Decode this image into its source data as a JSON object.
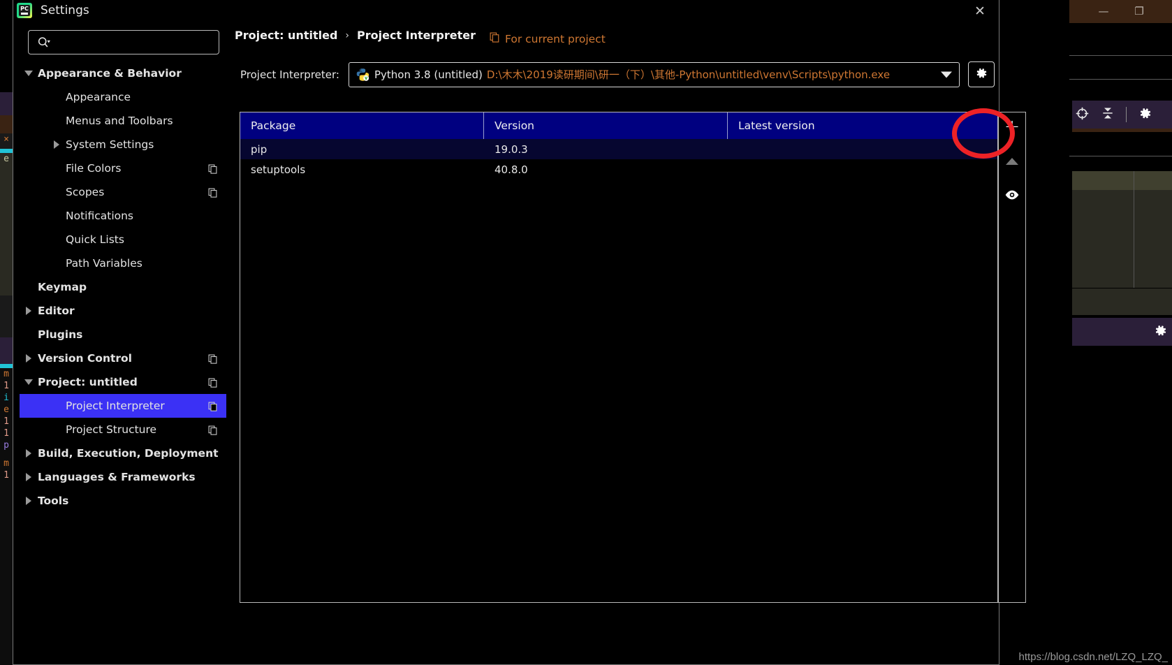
{
  "dialog": {
    "app_icon": "pycharm-icon",
    "title": "Settings",
    "close_label": "✕",
    "search": {
      "placeholder": "",
      "value": "",
      "icon": "search-icon"
    }
  },
  "sidebar": {
    "items": [
      {
        "label": "Appearance & Behavior",
        "indent": 0,
        "bold": true,
        "twisty": "down",
        "copy": false
      },
      {
        "label": "Appearance",
        "indent": 1,
        "bold": false,
        "twisty": "none",
        "copy": false
      },
      {
        "label": "Menus and Toolbars",
        "indent": 1,
        "bold": false,
        "twisty": "none",
        "copy": false
      },
      {
        "label": "System Settings",
        "indent": 1,
        "bold": false,
        "twisty": "right",
        "copy": false
      },
      {
        "label": "File Colors",
        "indent": 1,
        "bold": false,
        "twisty": "none",
        "copy": true
      },
      {
        "label": "Scopes",
        "indent": 1,
        "bold": false,
        "twisty": "none",
        "copy": true
      },
      {
        "label": "Notifications",
        "indent": 1,
        "bold": false,
        "twisty": "none",
        "copy": false
      },
      {
        "label": "Quick Lists",
        "indent": 1,
        "bold": false,
        "twisty": "none",
        "copy": false
      },
      {
        "label": "Path Variables",
        "indent": 1,
        "bold": false,
        "twisty": "none",
        "copy": false
      },
      {
        "label": "Keymap",
        "indent": 0,
        "bold": true,
        "twisty": "none",
        "copy": false
      },
      {
        "label": "Editor",
        "indent": 0,
        "bold": true,
        "twisty": "right",
        "copy": false
      },
      {
        "label": "Plugins",
        "indent": 0,
        "bold": true,
        "twisty": "none",
        "copy": false
      },
      {
        "label": "Version Control",
        "indent": 0,
        "bold": true,
        "twisty": "right",
        "copy": true
      },
      {
        "label": "Project: untitled",
        "indent": 0,
        "bold": true,
        "twisty": "down",
        "copy": true
      },
      {
        "label": "Project Interpreter",
        "indent": 1,
        "bold": false,
        "twisty": "none",
        "copy": true,
        "selected": true
      },
      {
        "label": "Project Structure",
        "indent": 1,
        "bold": false,
        "twisty": "none",
        "copy": true
      },
      {
        "label": "Build, Execution, Deployment",
        "indent": 0,
        "bold": true,
        "twisty": "right",
        "copy": false
      },
      {
        "label": "Languages & Frameworks",
        "indent": 0,
        "bold": true,
        "twisty": "right",
        "copy": false
      },
      {
        "label": "Tools",
        "indent": 0,
        "bold": true,
        "twisty": "right",
        "copy": false
      }
    ],
    "selected_color": "#3b31f5"
  },
  "content": {
    "breadcrumb": {
      "parent": "Project: untitled",
      "separator": "›",
      "current": "Project Interpreter"
    },
    "for_current_project": {
      "label": "For current project",
      "icon": "copy-icon",
      "color": "#cf7732"
    },
    "interpreter": {
      "label": "Project Interpreter:",
      "icon": "python-venv-icon",
      "name": "Python 3.8 (untitled)",
      "path": "D:\\木木\\2019读研期间\\研一（下）\\其他-Python\\untitled\\venv\\Scripts\\python.exe",
      "dropdown_icon": "chevron-down-icon",
      "settings_icon": "gear-icon"
    },
    "packages_table": {
      "columns": [
        "Package",
        "Version",
        "Latest version"
      ],
      "header_color": "#000080",
      "rows": [
        {
          "package": "pip",
          "version": "19.0.3",
          "latest": "",
          "selected": true
        },
        {
          "package": "setuptools",
          "version": "40.8.0",
          "latest": "",
          "selected": false
        }
      ]
    },
    "toolbar_rail": [
      {
        "name": "add-package-button",
        "icon": "plus-icon",
        "label": "+"
      },
      {
        "name": "upgrade-package-button",
        "icon": "up-arrow-icon",
        "label": ""
      },
      {
        "name": "show-early-releases-button",
        "icon": "eye-icon",
        "label": ""
      }
    ],
    "annotation": {
      "shape": "ellipse",
      "color": "#ed2226",
      "targets": "add-package-button"
    }
  },
  "background_ide": {
    "minimize_label": "—",
    "restore_label": "❐",
    "toolbar_icons": [
      "target-icon",
      "collapse-icon",
      "gear-icon"
    ],
    "bottom_icon": "gear-icon"
  },
  "watermark": "https://blog.csdn.net/LZQ_LZQ_"
}
